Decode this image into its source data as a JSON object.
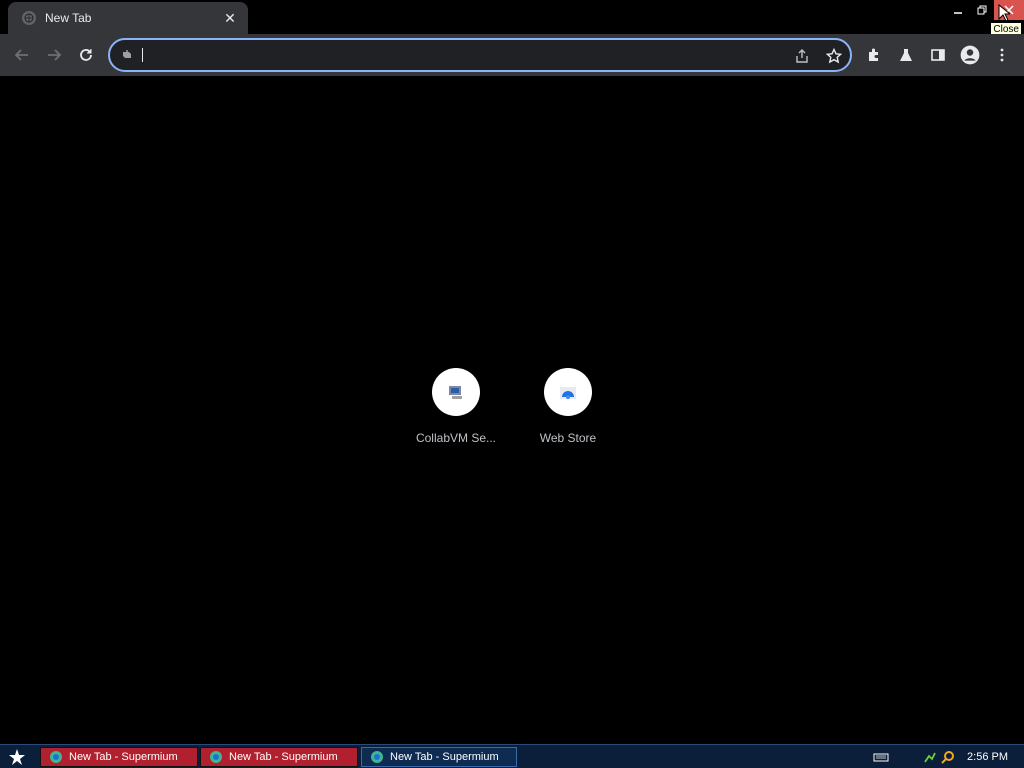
{
  "browser": {
    "tab": {
      "title": "New Tab"
    },
    "window": {
      "close_tooltip": "Close"
    },
    "omnibox": {
      "value": "",
      "placeholder": ""
    },
    "accent": "#8ab4f8"
  },
  "shortcuts": [
    {
      "label": "CollabVM Se...",
      "icon": "collabvm-icon"
    },
    {
      "label": "Web Store",
      "icon": "web-store-icon"
    }
  ],
  "taskbar": {
    "tasks": [
      {
        "label": "New Tab - Supermium",
        "state": "red"
      },
      {
        "label": "New Tab - Supermium",
        "state": "red"
      },
      {
        "label": "New Tab - Supermium",
        "state": "active"
      }
    ],
    "clock": "2:56 PM"
  }
}
